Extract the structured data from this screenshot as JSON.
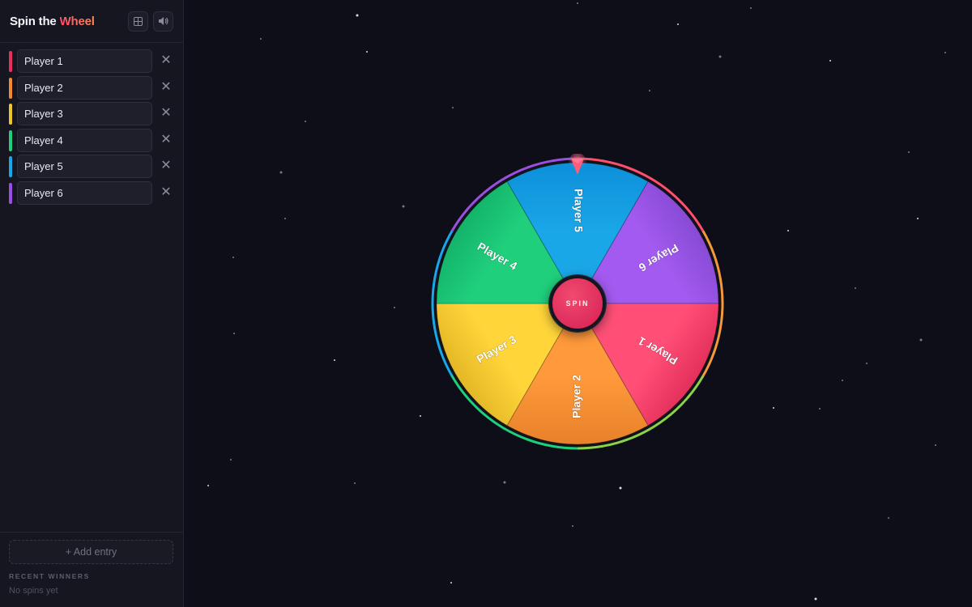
{
  "app": {
    "title_main": "Spin the ",
    "title_accent": "Wheel"
  },
  "header": {
    "grid_icon": "grid-icon",
    "sound_icon": "speaker-icon"
  },
  "entries": [
    {
      "value": "Player 1",
      "color": "#e8305e"
    },
    {
      "value": "Player 2",
      "color": "#f28a30"
    },
    {
      "value": "Player 3",
      "color": "#ecc72a"
    },
    {
      "value": "Player 4",
      "color": "#1fcf7b"
    },
    {
      "value": "Player 5",
      "color": "#1aa7e8"
    },
    {
      "value": "Player 6",
      "color": "#9b4fe0"
    }
  ],
  "remove_glyph": "✕",
  "footer": {
    "add_label": "+ Add entry",
    "recent_title": "RECENT WINNERS",
    "recent_empty": "No spins yet"
  },
  "wheel": {
    "spin_label": "SPIN",
    "segments": [
      "Player 5",
      "Player 6",
      "Player 1",
      "Player 2",
      "Player 3",
      "Player 4"
    ]
  }
}
